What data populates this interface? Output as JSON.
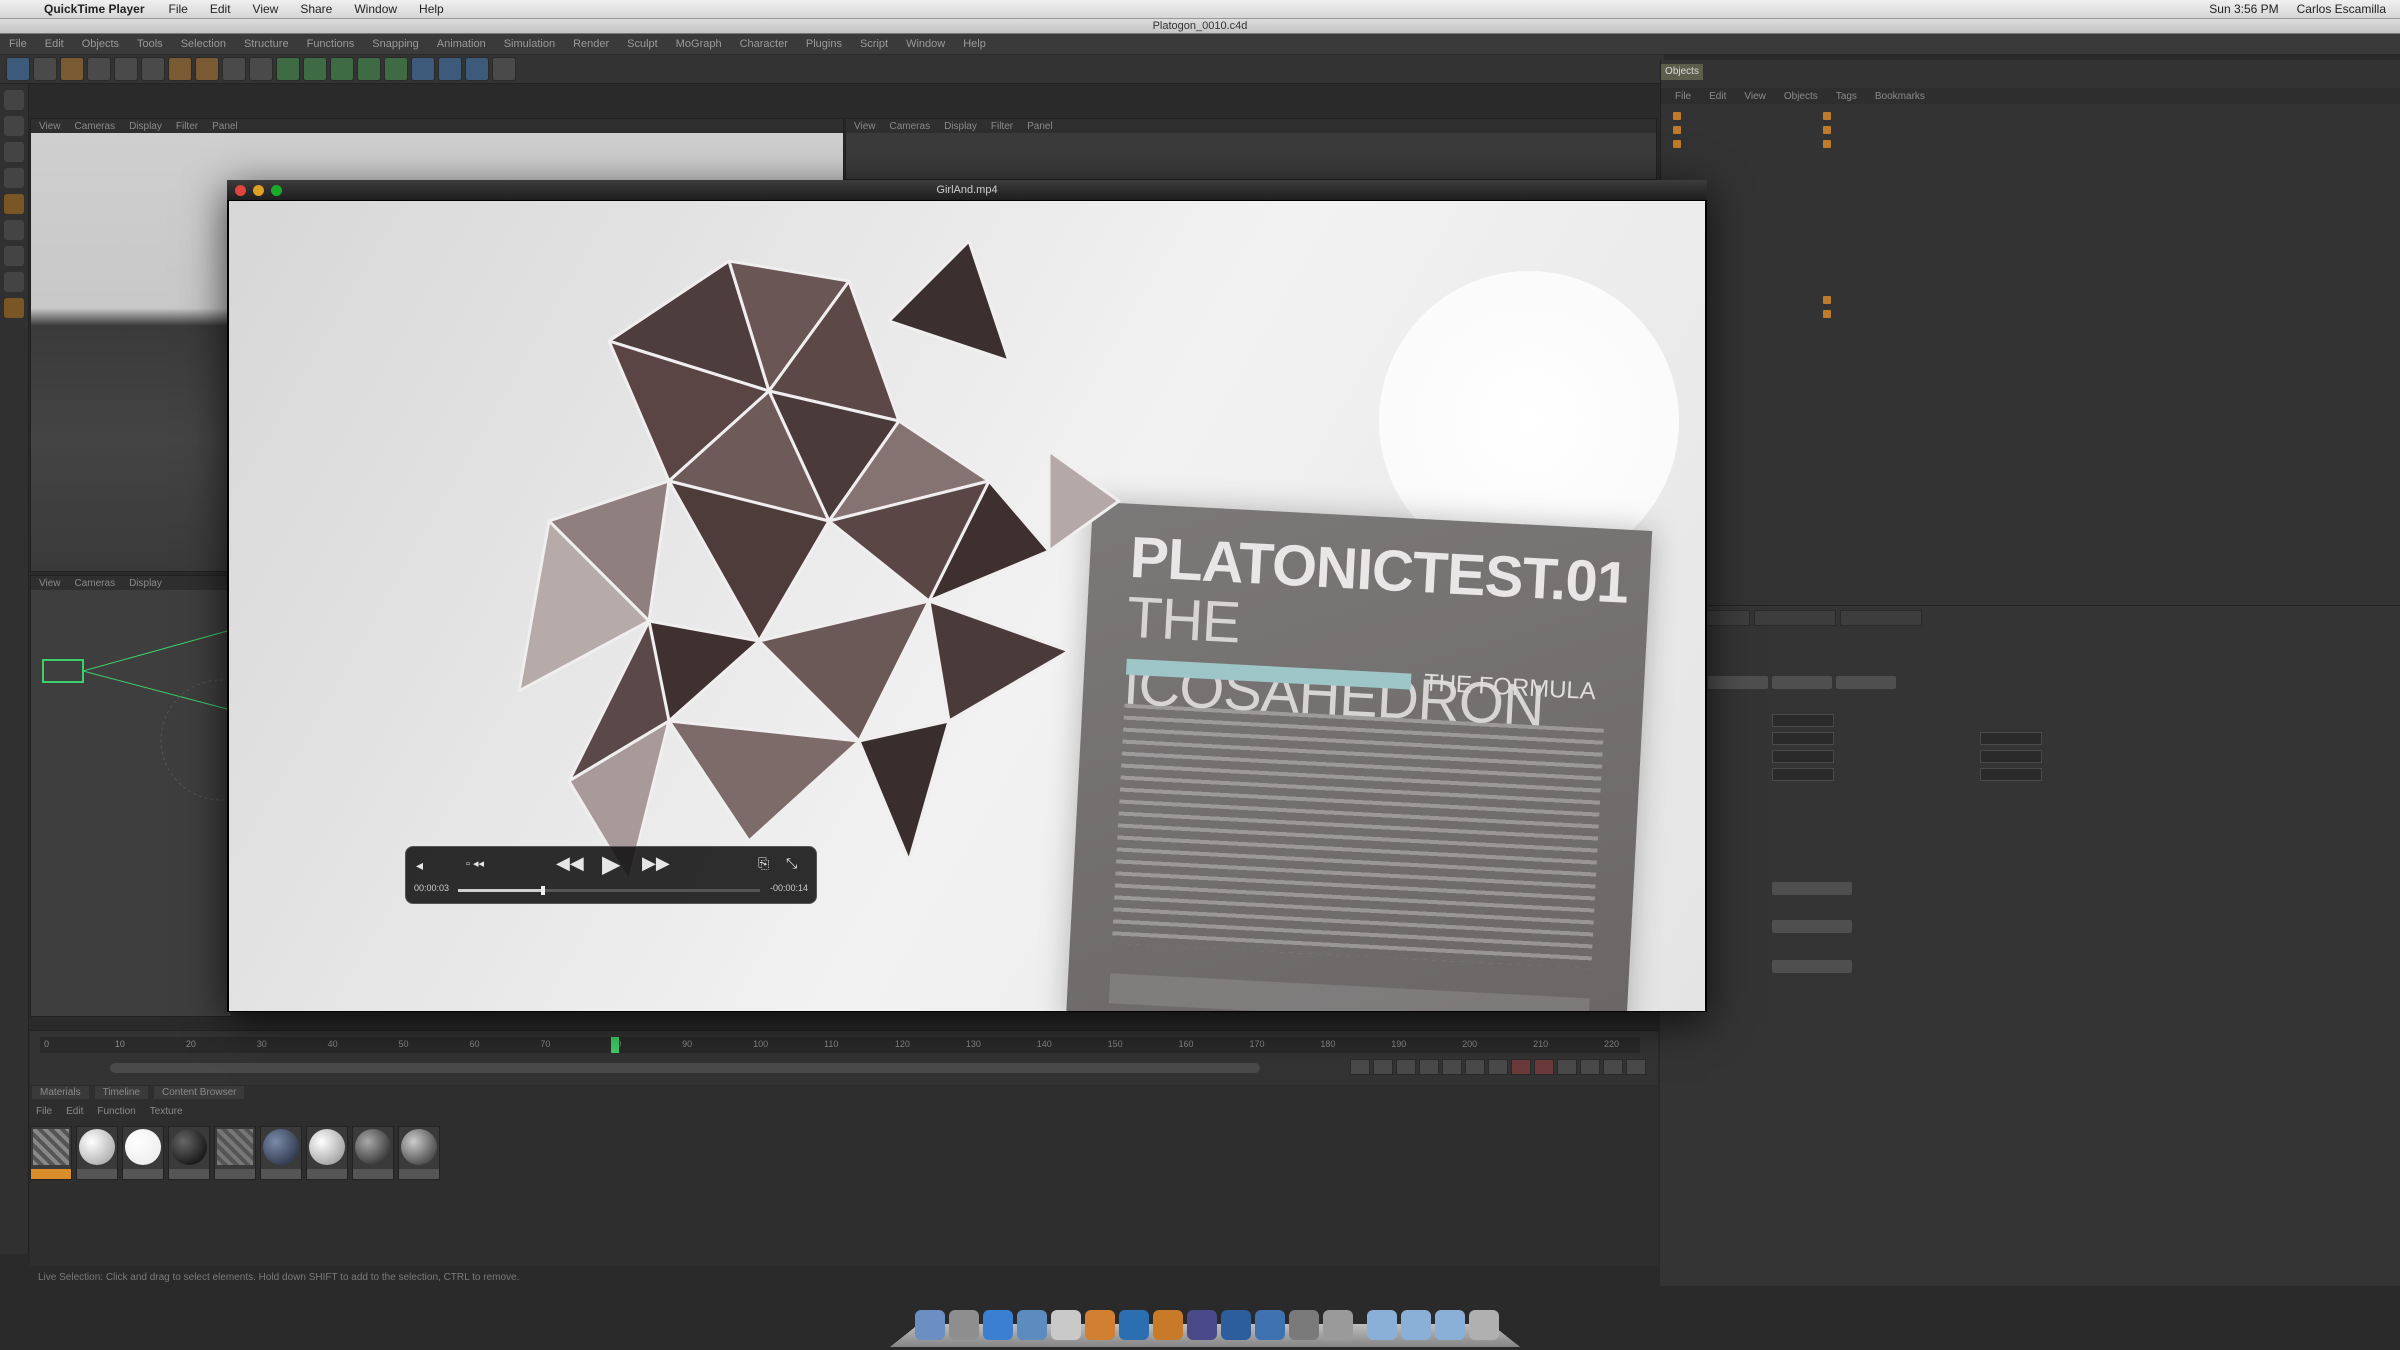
{
  "menubar": {
    "app_name": "QuickTime Player",
    "items": [
      "File",
      "Edit",
      "View",
      "Share",
      "Window",
      "Help"
    ],
    "clock": "Sun 3:56 PM",
    "user": "Carlos Escamilla"
  },
  "app_window_title": "Platogon_0010.c4d",
  "c4d_menu": [
    "File",
    "Edit",
    "Objects",
    "Tools",
    "Selection",
    "Structure",
    "Functions",
    "Snapping",
    "Animation",
    "Simulation",
    "Render",
    "Sculpt",
    "MoGraph",
    "Character",
    "Plugins",
    "Script",
    "Window",
    "Help"
  ],
  "viewport_menu": [
    "View",
    "Cameras",
    "Display",
    "Filter",
    "Panel"
  ],
  "object_manager": {
    "tab": "Objects",
    "menu": [
      "File",
      "Edit",
      "View",
      "Objects",
      "Tags",
      "Bookmarks"
    ]
  },
  "qt": {
    "title": "GirlAnd.mp4",
    "time_elapsed": "00:00:03",
    "time_remaining": "-00:00:14",
    "progress": 0.28
  },
  "poster": {
    "title": "PLATONICTEST.01",
    "subtitle": "THE ICOSAHEDRON",
    "formula": "THE FORMULA"
  },
  "timeline": {
    "ticks": [
      "0",
      "10",
      "20",
      "30",
      "40",
      "50",
      "60",
      "70",
      "80",
      "90",
      "100",
      "110",
      "120",
      "130",
      "140",
      "150",
      "160",
      "170",
      "180",
      "190",
      "200",
      "210",
      "220"
    ],
    "playhead": 80,
    "max": 220
  },
  "materials": {
    "tabs": [
      "Materials",
      "Timeline",
      "Content Browser"
    ],
    "menu": [
      "File",
      "Edit",
      "Function",
      "Texture"
    ]
  },
  "status": "Live Selection: Click and drag to select elements. Hold down SHIFT to add to the selection, CTRL to remove.",
  "colors": {
    "accent_orange": "#d98c2a",
    "playhead_green": "#3fcf6a",
    "poster_bar": "#9ec5c8"
  }
}
